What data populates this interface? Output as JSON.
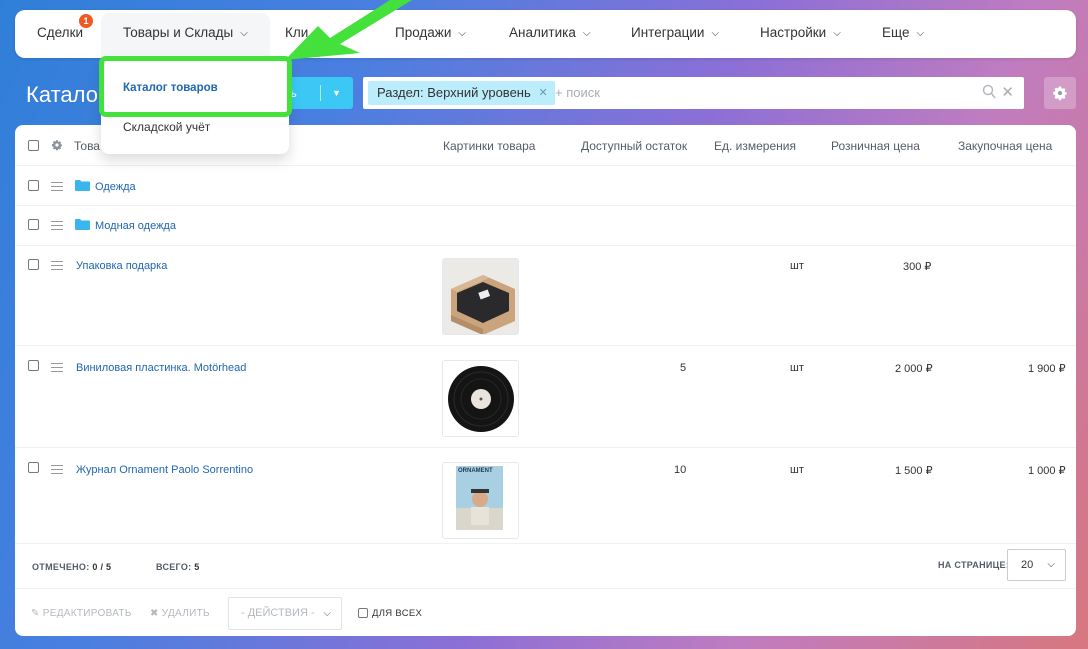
{
  "nav": {
    "deals": "Сделки",
    "deals_badge": "1",
    "goods": "Товары и Склады",
    "clients": "Кли",
    "sales": "Продажи",
    "analytics": "Аналитика",
    "integrations": "Интеграции",
    "settings": "Настройки",
    "more": "Еще"
  },
  "page": {
    "title": "Каталог",
    "create_label": "ть"
  },
  "filter": {
    "chip": "Раздел: Верхний уровень",
    "placeholder": "+ поиск"
  },
  "dropdown": {
    "catalog": "Каталог товаров",
    "warehouse": "Складской учёт"
  },
  "table": {
    "headers": {
      "name": "Това",
      "images": "Картинки товара",
      "available": "Доступный остаток",
      "unit": "Ед. измерения",
      "retail": "Розничная цена",
      "purchase": "Закупочная цена"
    },
    "rows": [
      {
        "name": "Одежда",
        "type": "folder"
      },
      {
        "name": "Модная одежда",
        "type": "folder"
      },
      {
        "name": "Упаковка подарка",
        "available": "",
        "unit": "шт",
        "retail": "300 ₽",
        "purchase": ""
      },
      {
        "name": "Виниловая пластинка. Motörhead",
        "available": "5",
        "unit": "шт",
        "retail": "2 000 ₽",
        "purchase": "1 900 ₽"
      },
      {
        "name": "Журнал Ornament Paolo Sorrentino",
        "available": "10",
        "unit": "шт",
        "retail": "1 500 ₽",
        "purchase": "1 000 ₽"
      }
    ],
    "magazine_cover_text": "ORNAMENT"
  },
  "footer": {
    "marked_label": "ОТМЕЧЕНО:",
    "marked_value": "0 / 5",
    "total_label": "ВСЕГО:",
    "total_value": "5",
    "per_page_label": "НА СТРАНИЦЕ:",
    "per_page_value": "20",
    "edit": "РЕДАКТИРОВАТЬ",
    "delete": "УДАЛИТЬ",
    "actions": "- ДЕЙСТВИЯ -",
    "for_all": "ДЛЯ ВСЕХ"
  },
  "colors": {
    "accent": "#3bc8f5",
    "link": "#2067b0",
    "highlight": "#44e03c",
    "badge": "#f05a22"
  }
}
